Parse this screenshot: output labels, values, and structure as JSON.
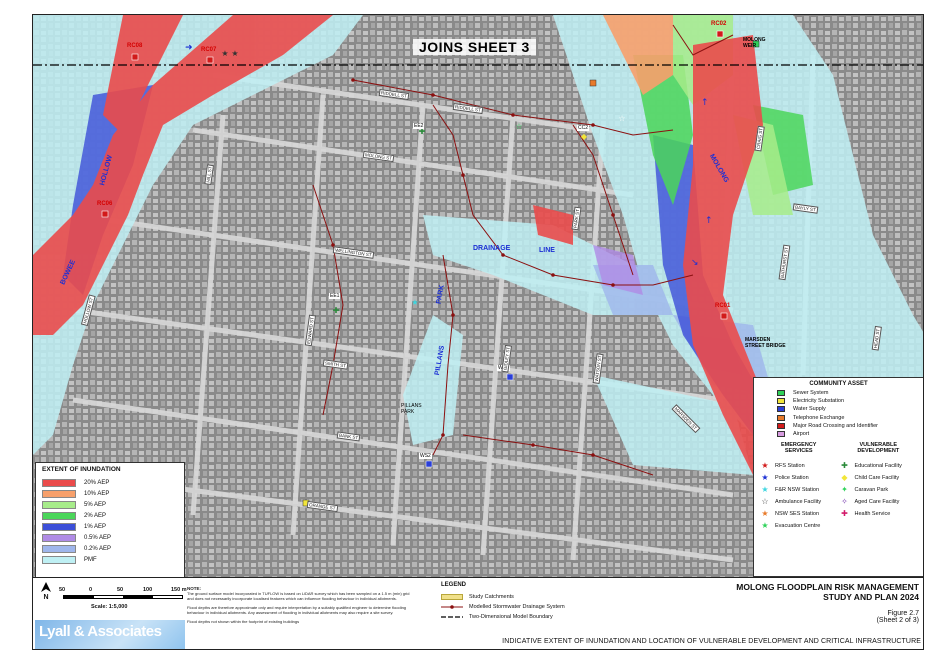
{
  "map": {
    "joins_label": "JOINS SHEET 3",
    "road_crossings": [
      "RC08",
      "RC07",
      "RC06",
      "RC02",
      "RC01"
    ],
    "weir_label": "MOLONG\nWEIR",
    "bridge_label": "MARSDEN\nSTREET BRIDGE",
    "creek_labels": [
      "HOLLOW",
      "BOWEE",
      "MOLONG",
      "DRAINAGE",
      "LINE",
      "PARK",
      "PILLANS"
    ],
    "park_label": "PILLANS\nPARK",
    "asset_labels": [
      "EE2",
      "EE1",
      "CC2",
      "WS1",
      "WS2"
    ],
    "street_labels": [
      "WELLINGTON ST",
      "SMITH ST",
      "RIDDELL ST",
      "HILL ST",
      "GIDLEY ST",
      "WATSON ST",
      "RIDDELL ST",
      "MOLONG ST",
      "BANK ST",
      "EDWARD ST",
      "CRAIG ST",
      "ORANGE ST",
      "BAYLY ST",
      "BATHURST ST",
      "MARSDEN ST",
      "HOLLOW ST",
      "PARK ST",
      "HEAD ST"
    ]
  },
  "extent_legend": {
    "title": "EXTENT OF INUNDATION",
    "items": [
      {
        "label": "20% AEP",
        "color": "#ea4b4b"
      },
      {
        "label": "10% AEP",
        "color": "#f7a06b"
      },
      {
        "label": "5% AEP",
        "color": "#a7ec8a"
      },
      {
        "label": "2% AEP",
        "color": "#4bd65a"
      },
      {
        "label": "1% AEP",
        "color": "#3c4fd8"
      },
      {
        "label": "0.5% AEP",
        "color": "#b08be6"
      },
      {
        "label": "0.2% AEP",
        "color": "#9fb6ec"
      },
      {
        "label": "PMF",
        "color": "#bff0f4"
      }
    ]
  },
  "community_asset": {
    "title": "COMMUNITY ASSET",
    "items": [
      {
        "label": "Sewer System",
        "color": "#2fd25a"
      },
      {
        "label": "Electricity Substation",
        "color": "#f2e63a"
      },
      {
        "label": "Water Supply",
        "color": "#2a3fd8"
      },
      {
        "label": "Telephone Exchange",
        "color": "#e87a2a"
      },
      {
        "label": "Major Road Crossing and Identifier",
        "color": "#d21a1a"
      },
      {
        "label": "Airport",
        "color": "#d79be0"
      }
    ],
    "emergency_title": "EMERGENCY\nSERVICES",
    "emergency": [
      {
        "label": "RFS Station",
        "symbol": "★",
        "color": "#d21a1a"
      },
      {
        "label": "Police Station",
        "symbol": "★",
        "color": "#1b2fd4"
      },
      {
        "label": "F&R NSW Station",
        "symbol": "★",
        "color": "#3dd6e0"
      },
      {
        "label": "Ambulance Facility",
        "symbol": "☆",
        "color": "#333333"
      },
      {
        "label": "NSW SES Station",
        "symbol": "★",
        "color": "#e87a2a"
      },
      {
        "label": "Evacuation Centre",
        "symbol": "★",
        "color": "#2fd25a"
      }
    ],
    "vulnerable_title": "VULNERABLE\nDEVELOPMENT",
    "vulnerable": [
      {
        "label": "Educational Facility",
        "symbol": "✚",
        "color": "#2a8a3a"
      },
      {
        "label": "Child Care Facility",
        "symbol": "◆",
        "color": "#f2e63a"
      },
      {
        "label": "Caravan Park",
        "symbol": "✦",
        "color": "#2fd25a"
      },
      {
        "label": "Aged Care Facility",
        "symbol": "✧",
        "color": "#7a3fb0"
      },
      {
        "label": "Health Service",
        "symbol": "✚",
        "color": "#d21a6a"
      }
    ]
  },
  "footer": {
    "north": "N",
    "scale_numbers": [
      "50",
      "0",
      "50",
      "100",
      "150 m"
    ],
    "scale_text": "Scale: 1:5,000",
    "logo_text": "Lyall & Associates",
    "note_title": "NOTE:",
    "note_lines": [
      "The ground surface model incorporated in TUFLOW is based on LiDAR survey which has been sampled on a 1.5 m (min) grid and does not necessarily incorporate localised features which can influence flooding behaviour in individual allotments.",
      "Flood depths are therefore approximate only and require interpretation by a suitably qualified engineer to determine flooding behaviour in individual allotments. Any assessment of flooding in individual allotments may also require a site survey.",
      "Flood depths not shown within the footprint of existing buildings"
    ],
    "legend_title": "LEGEND",
    "legend_items": [
      "Study Catchments",
      "Modelled Stormwater Drainage System",
      "Two-Dimensional Model Boundary"
    ],
    "title_1": "MOLONG FLOODPLAIN RISK MANAGEMENT",
    "title_2": "STUDY AND PLAN 2024",
    "figure": "Figure 2.7",
    "sheet": "(Sheet 2 of 3)",
    "caption": "INDICATIVE EXTENT OF INUNDATION AND LOCATION OF VULNERABLE DEVELOPMENT AND CRITICAL INFRASTRUCTURE"
  }
}
